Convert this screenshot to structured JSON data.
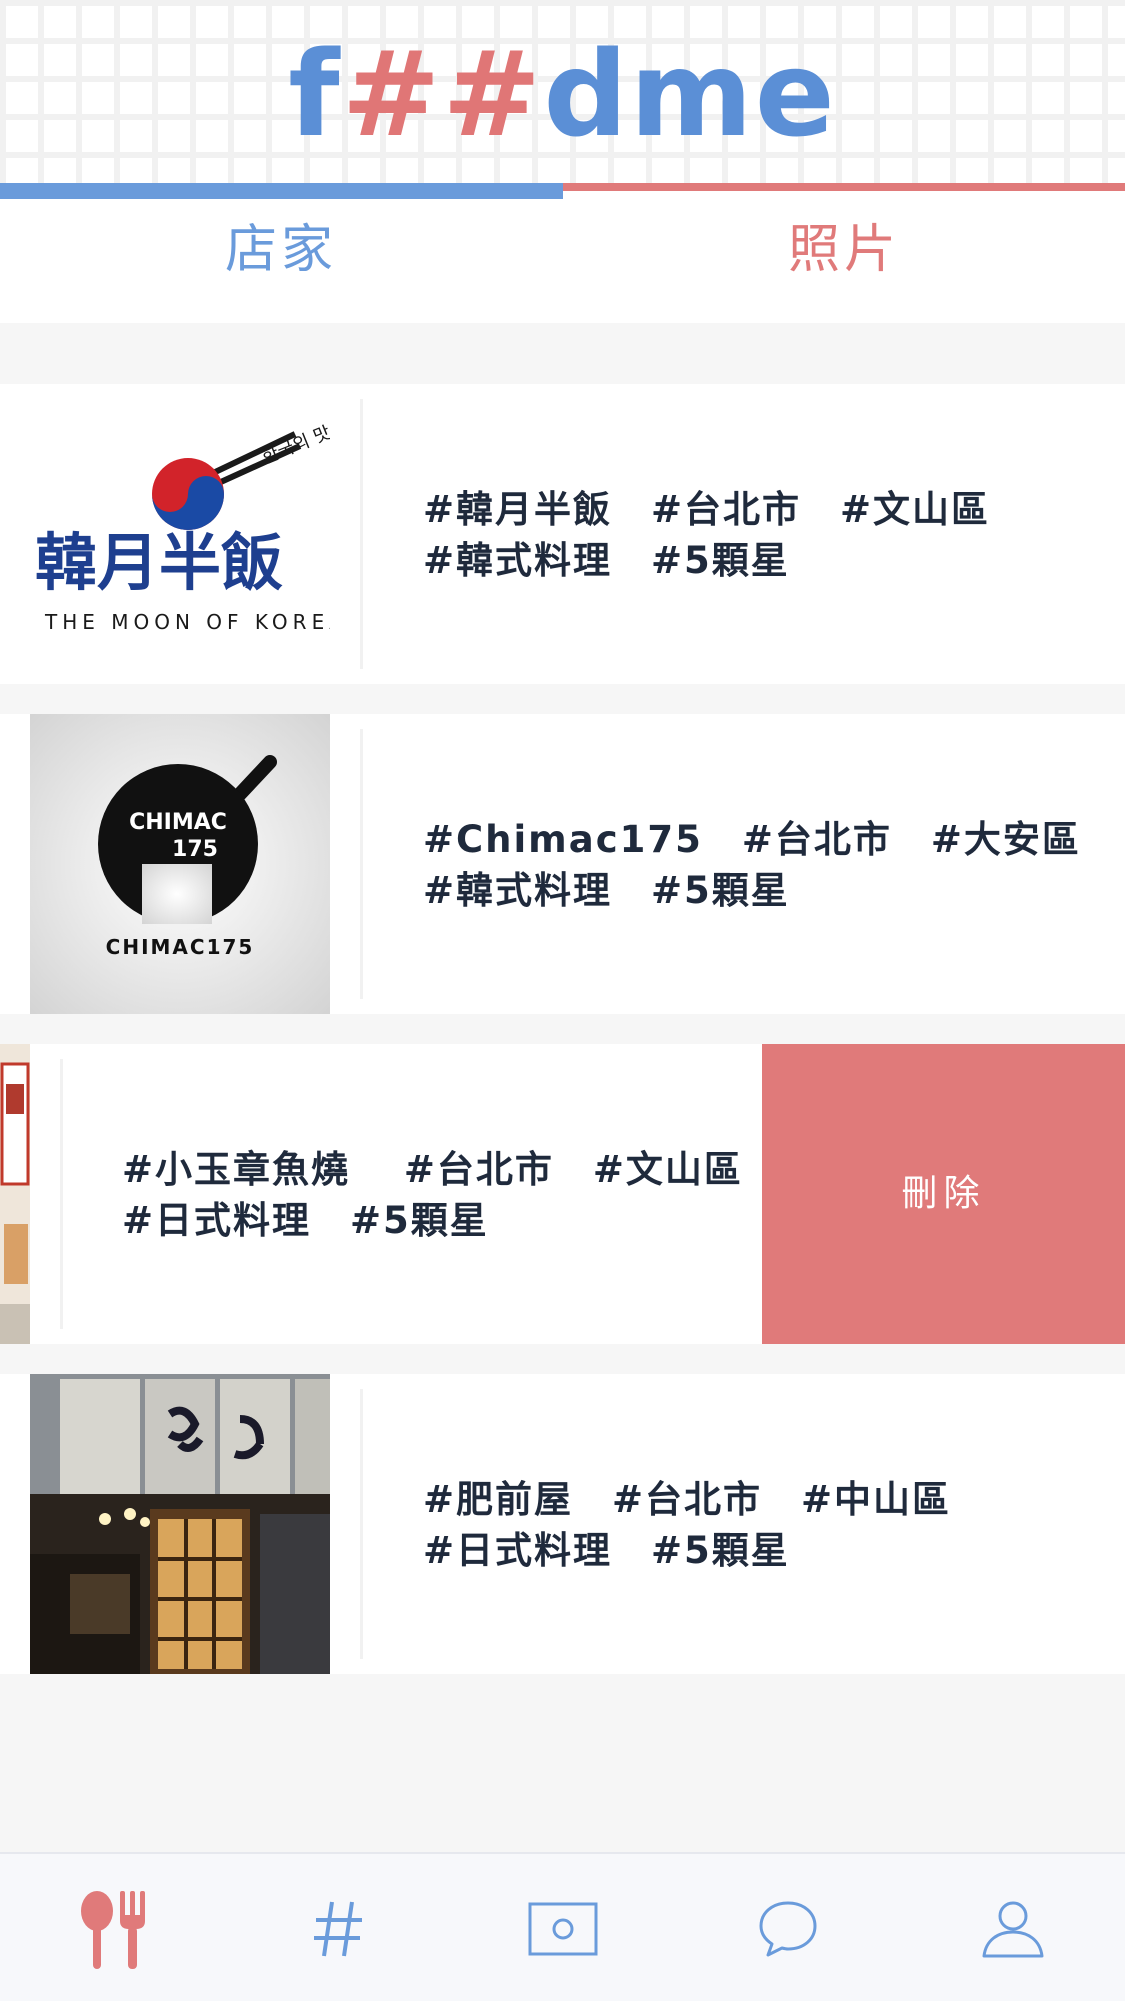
{
  "app": {
    "logo_parts": [
      {
        "text": "f",
        "color": "blue"
      },
      {
        "text": "##",
        "color": "red"
      },
      {
        "text": "dme",
        "color": "blue"
      }
    ]
  },
  "tabs": [
    {
      "label": "店家",
      "active": true
    },
    {
      "label": "照片",
      "active": false
    }
  ],
  "stores": [
    {
      "tags_line1": "#韓月半飯　#台北市　#文山區",
      "tags_line2": "#韓式料理　#5顆星",
      "logo_text_main": "韓月半飯",
      "logo_text_sub": "THE MOON OF KOREA",
      "logo_text_kr": "한국의 맛"
    },
    {
      "tags_line1": "#Chimac175　#台北市　#大安區",
      "tags_line2": "#韓式料理　#5顆星",
      "logo_text_main": "CHIMAC",
      "logo_text_num": "175",
      "logo_text_sub": "CHIMAC175"
    },
    {
      "tags_line1": "#小玉章魚燒　 #台北市　#文山區",
      "tags_line2": "#日式料理　#5顆星",
      "delete_label": "刪除",
      "swiped": true
    },
    {
      "tags_line1": "#肥前屋　#台北市　#中山區",
      "tags_line2": "#日式料理　#5顆星"
    }
  ],
  "bottom_nav": [
    {
      "icon": "utensils-icon",
      "active": true
    },
    {
      "icon": "hashtag-icon",
      "active": false
    },
    {
      "icon": "photo-icon",
      "active": false
    },
    {
      "icon": "chat-icon",
      "active": false
    },
    {
      "icon": "profile-icon",
      "active": false
    }
  ],
  "colors": {
    "blue": "#6a9bdb",
    "red": "#e07a7a",
    "text": "#1f2a3c",
    "background": "#f6f6f6"
  }
}
